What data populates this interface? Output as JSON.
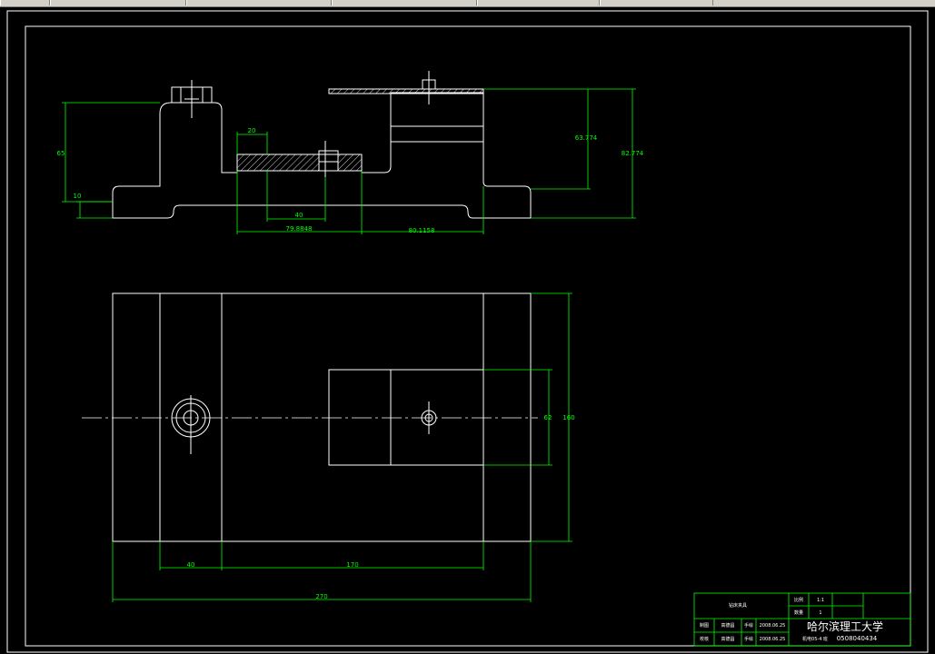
{
  "window": {
    "toolbar_segments": 6
  },
  "colors": {
    "background": "#000000",
    "geometry": "#ffffff",
    "dimension": "#00ff00",
    "frame": "#ffffff"
  },
  "side_view": {
    "dims": {
      "d_65": "65",
      "d_10": "10",
      "d_20": "20",
      "d_40": "40",
      "d_79": "79.8848",
      "d_80": "80.1158",
      "d_63": "63.774",
      "d_82": "82.774"
    }
  },
  "top_view": {
    "dims": {
      "d_62": "62",
      "d_160": "160",
      "d_40": "40",
      "d_170": "170",
      "d_270": "270"
    }
  },
  "title_block": {
    "drawing_name": "钻床夹具",
    "scale_label": "比例",
    "scale_value": "1:1",
    "qty_label": "数量",
    "qty_value": "1",
    "drawn_label": "制图",
    "checked_label": "校核",
    "drawn_name": "高德昌",
    "checked_name": "高德昌",
    "drawn_flag": "手绘",
    "checked_flag": "手绘",
    "drawn_date": "2008.06.25",
    "checked_date": "2008.06.25",
    "university": "哈尔滨理工大学",
    "class_code": "机电05-4 班",
    "student_id": "0508040434"
  }
}
